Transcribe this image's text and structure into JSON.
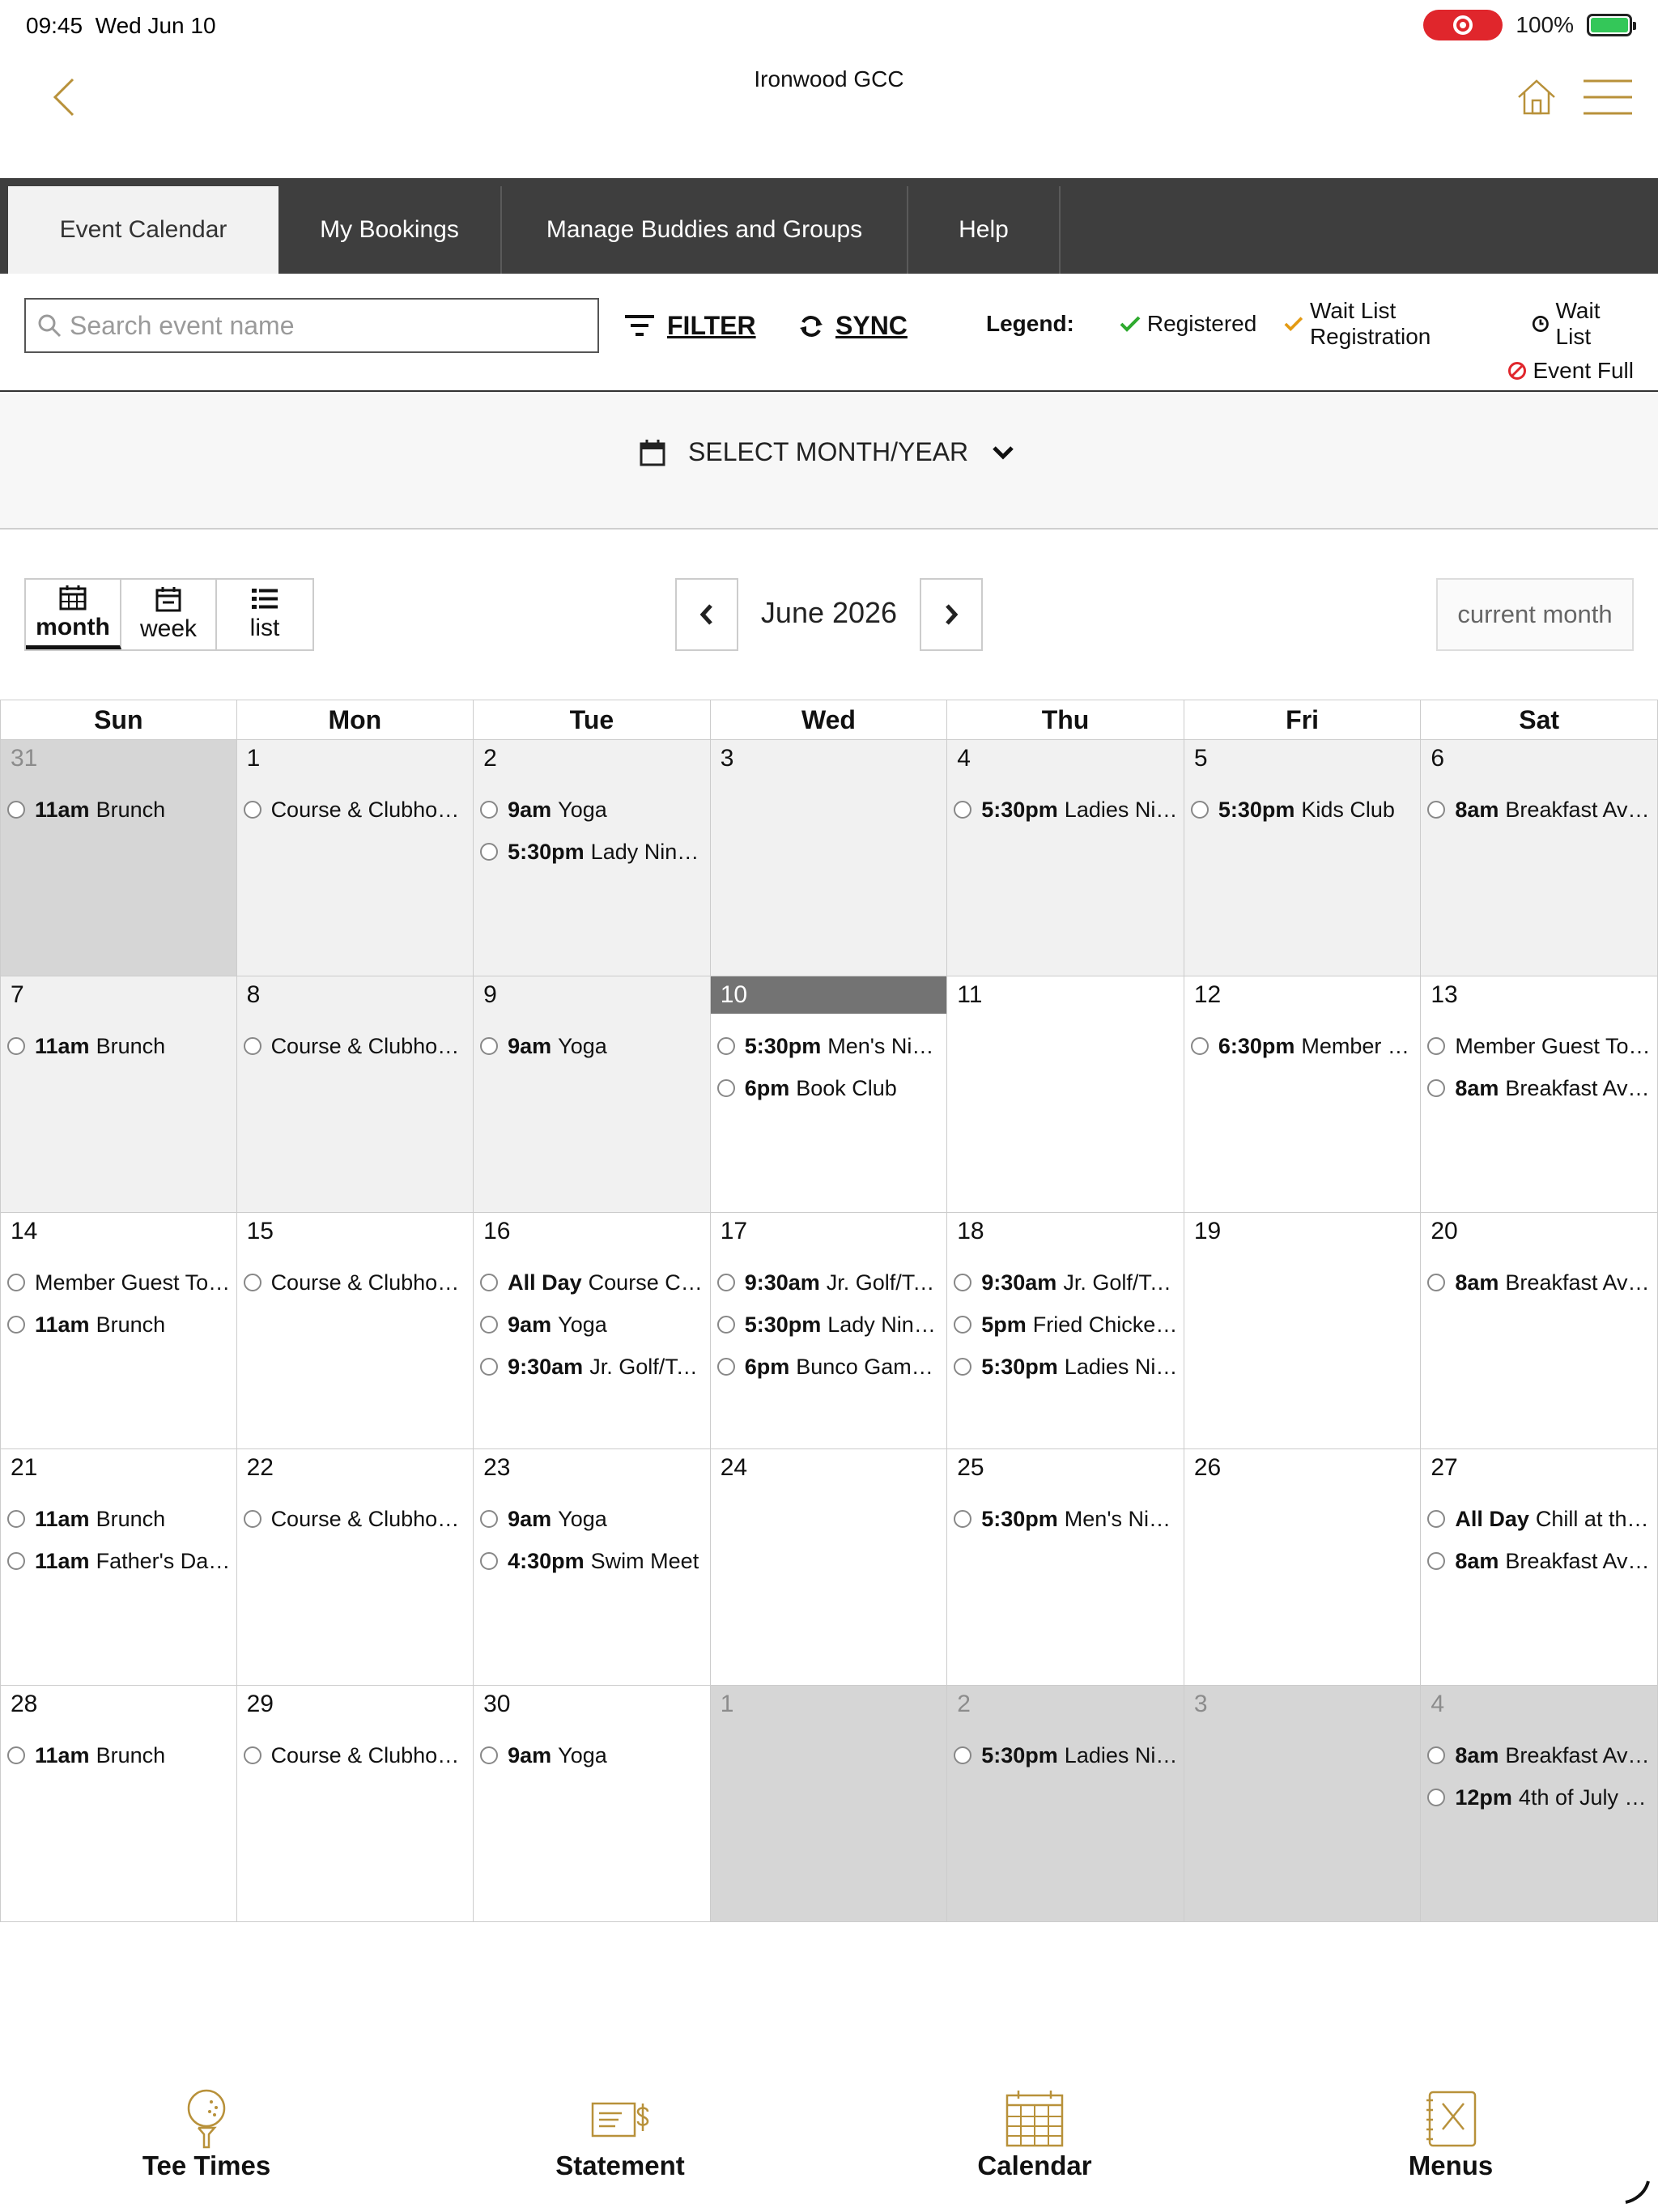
{
  "status_bar": {
    "time": "09:45",
    "date": "Wed Jun 10",
    "battery": "100%"
  },
  "header": {
    "title": "Ironwood GCC"
  },
  "tabs": [
    {
      "label": "Event Calendar",
      "active": true
    },
    {
      "label": "My Bookings",
      "active": false
    },
    {
      "label": "Manage Buddies and Groups",
      "active": false
    },
    {
      "label": "Help",
      "active": false
    }
  ],
  "toolbar": {
    "search_placeholder": "Search event name",
    "filter_label": "FILTER",
    "sync_label": "SYNC"
  },
  "legend": {
    "title": "Legend:",
    "registered": "Registered",
    "wait_list_registration": "Wait List Registration",
    "wait_list": "Wait List",
    "event_full": "Event Full",
    "colors": {
      "registered": "#2eaa2e",
      "wait_list_registration": "#e39a12",
      "event_full": "#e0262c"
    }
  },
  "month_select": {
    "label": "SELECT MONTH/YEAR"
  },
  "views": [
    {
      "label": "month",
      "icon": "calendar-grid-icon",
      "active": true
    },
    {
      "label": "week",
      "icon": "calendar-week-icon",
      "active": false
    },
    {
      "label": "list",
      "icon": "list-icon",
      "active": false
    }
  ],
  "pager": {
    "label": "June 2026",
    "current_button": "current month"
  },
  "weekdays": [
    "Sun",
    "Mon",
    "Tue",
    "Wed",
    "Thu",
    "Fri",
    "Sat"
  ],
  "weeks": [
    [
      {
        "day": "31",
        "style": "dark",
        "other": true,
        "events": [
          {
            "time": "11am",
            "title": "Brunch"
          }
        ]
      },
      {
        "day": "1",
        "style": "past",
        "events": [
          {
            "time": "",
            "title": "Course & Clubhouse Closed"
          }
        ]
      },
      {
        "day": "2",
        "style": "past",
        "events": [
          {
            "time": "9am",
            "title": "Yoga"
          },
          {
            "time": "5:30pm",
            "title": "Lady Niners"
          }
        ]
      },
      {
        "day": "3",
        "style": "past",
        "events": []
      },
      {
        "day": "4",
        "style": "past",
        "events": [
          {
            "time": "5:30pm",
            "title": "Ladies Night"
          }
        ]
      },
      {
        "day": "5",
        "style": "past",
        "events": [
          {
            "time": "5:30pm",
            "title": "Kids Club"
          }
        ]
      },
      {
        "day": "6",
        "style": "past",
        "events": [
          {
            "time": "8am",
            "title": "Breakfast Available"
          }
        ]
      }
    ],
    [
      {
        "day": "7",
        "style": "past",
        "events": [
          {
            "time": "11am",
            "title": "Brunch"
          }
        ]
      },
      {
        "day": "8",
        "style": "past",
        "events": [
          {
            "time": "",
            "title": "Course & Clubhouse Closed"
          }
        ]
      },
      {
        "day": "9",
        "style": "past",
        "events": [
          {
            "time": "9am",
            "title": "Yoga"
          }
        ]
      },
      {
        "day": "10",
        "style": "today",
        "events": [
          {
            "time": "5:30pm",
            "title": "Men's Night"
          },
          {
            "time": "6pm",
            "title": "Book Club"
          }
        ]
      },
      {
        "day": "11",
        "style": "",
        "events": []
      },
      {
        "day": "12",
        "style": "",
        "events": [
          {
            "time": "6:30pm",
            "title": "Member Mixer"
          }
        ]
      },
      {
        "day": "13",
        "style": "",
        "events": [
          {
            "time": "",
            "title": "Member Guest Tournament"
          },
          {
            "time": "8am",
            "title": "Breakfast Available"
          }
        ]
      }
    ],
    [
      {
        "day": "14",
        "style": "",
        "events": [
          {
            "time": "",
            "title": "Member Guest Tournament"
          },
          {
            "time": "11am",
            "title": "Brunch"
          }
        ]
      },
      {
        "day": "15",
        "style": "",
        "events": [
          {
            "time": "",
            "title": "Course & Clubhouse Closed"
          }
        ]
      },
      {
        "day": "16",
        "style": "",
        "events": [
          {
            "time": "All Day",
            "title": "Course Closed"
          },
          {
            "time": "9am",
            "title": "Yoga"
          },
          {
            "time": "9:30am",
            "title": "Jr. Golf/Tennis"
          }
        ]
      },
      {
        "day": "17",
        "style": "",
        "events": [
          {
            "time": "9:30am",
            "title": "Jr. Golf/Tennis"
          },
          {
            "time": "5:30pm",
            "title": "Lady Niners"
          },
          {
            "time": "6pm",
            "title": "Bunco Game Night"
          }
        ]
      },
      {
        "day": "18",
        "style": "",
        "events": [
          {
            "time": "9:30am",
            "title": "Jr. Golf/Tennis"
          },
          {
            "time": "5pm",
            "title": "Fried Chicken Night"
          },
          {
            "time": "5:30pm",
            "title": "Ladies Night"
          }
        ]
      },
      {
        "day": "19",
        "style": "",
        "events": []
      },
      {
        "day": "20",
        "style": "",
        "events": [
          {
            "time": "8am",
            "title": "Breakfast Available"
          }
        ]
      }
    ],
    [
      {
        "day": "21",
        "style": "",
        "events": [
          {
            "time": "11am",
            "title": "Brunch"
          },
          {
            "time": "11am",
            "title": "Father's Day Brunch"
          }
        ]
      },
      {
        "day": "22",
        "style": "",
        "events": [
          {
            "time": "",
            "title": "Course & Clubhouse Closed"
          }
        ]
      },
      {
        "day": "23",
        "style": "",
        "events": [
          {
            "time": "9am",
            "title": "Yoga"
          },
          {
            "time": "4:30pm",
            "title": "Swim Meet"
          }
        ]
      },
      {
        "day": "24",
        "style": "",
        "events": []
      },
      {
        "day": "25",
        "style": "",
        "events": [
          {
            "time": "5:30pm",
            "title": "Men's Night"
          }
        ]
      },
      {
        "day": "26",
        "style": "",
        "events": []
      },
      {
        "day": "27",
        "style": "",
        "events": [
          {
            "time": "All Day",
            "title": "Chill at the Pool"
          },
          {
            "time": "8am",
            "title": "Breakfast Available"
          }
        ]
      }
    ],
    [
      {
        "day": "28",
        "style": "",
        "events": [
          {
            "time": "11am",
            "title": "Brunch"
          }
        ]
      },
      {
        "day": "29",
        "style": "",
        "events": [
          {
            "time": "",
            "title": "Course & Clubhouse Closed"
          }
        ]
      },
      {
        "day": "30",
        "style": "",
        "events": [
          {
            "time": "9am",
            "title": "Yoga"
          }
        ]
      },
      {
        "day": "1",
        "style": "dark",
        "other": true,
        "events": []
      },
      {
        "day": "2",
        "style": "dark",
        "other": true,
        "events": [
          {
            "time": "5:30pm",
            "title": "Ladies Night"
          }
        ]
      },
      {
        "day": "3",
        "style": "dark",
        "other": true,
        "events": []
      },
      {
        "day": "4",
        "style": "dark",
        "other": true,
        "events": [
          {
            "time": "8am",
            "title": "Breakfast Available"
          },
          {
            "time": "12pm",
            "title": "4th of July at the Club"
          }
        ]
      }
    ]
  ],
  "bottom_nav": [
    {
      "label": "Tee Times",
      "icon": "golf-ball-tee-icon"
    },
    {
      "label": "Statement",
      "icon": "statement-dollar-icon"
    },
    {
      "label": "Calendar",
      "icon": "calendar-icon"
    },
    {
      "label": "Menus",
      "icon": "menu-book-icon"
    }
  ],
  "accent_color": "#b8913a"
}
